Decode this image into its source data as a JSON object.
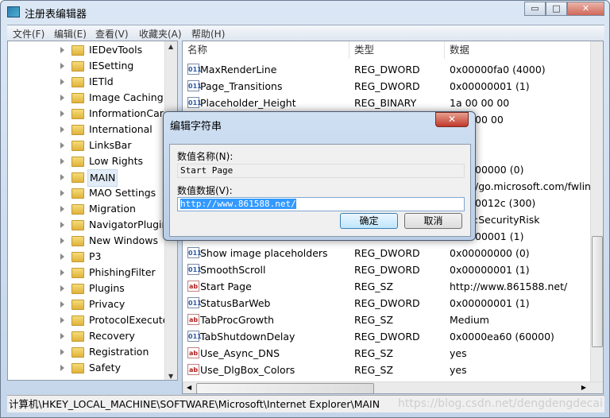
{
  "window": {
    "title": "注册表编辑器",
    "minimize": "▭",
    "maximize": "□",
    "close": "✕"
  },
  "menu": [
    "文件(F)",
    "编辑(E)",
    "查看(V)",
    "收藏夹(A)",
    "帮助(H)"
  ],
  "tree": {
    "items": [
      {
        "label": "IEDevTools"
      },
      {
        "label": "IESetting"
      },
      {
        "label": "IETld"
      },
      {
        "label": "Image Caching"
      },
      {
        "label": "InformationCard"
      },
      {
        "label": "International"
      },
      {
        "label": "LinksBar"
      },
      {
        "label": "Low Rights"
      },
      {
        "label": "MAIN",
        "selected": true
      },
      {
        "label": "MAO Settings"
      },
      {
        "label": "Migration"
      },
      {
        "label": "NavigatorPluginsL"
      },
      {
        "label": "New Windows"
      },
      {
        "label": "P3"
      },
      {
        "label": "PhishingFilter"
      },
      {
        "label": "Plugins"
      },
      {
        "label": "Privacy"
      },
      {
        "label": "ProtocolExecute"
      },
      {
        "label": "Recovery"
      },
      {
        "label": "Registration"
      },
      {
        "label": "Safety"
      }
    ]
  },
  "list": {
    "headers": {
      "name": "名称",
      "type": "类型",
      "data": "数据"
    },
    "rows": [
      {
        "icon": "dword-icon",
        "name": "MaxRenderLine",
        "type": "REG_DWORD",
        "data": "0x00000fa0 (4000)"
      },
      {
        "icon": "dword-icon",
        "name": "Page_Transitions",
        "type": "REG_DWORD",
        "data": "0x00000001 (1)"
      },
      {
        "icon": "dword-icon",
        "name": "Placeholder_Height",
        "type": "REG_BINARY",
        "data": "1a 00 00 00"
      },
      {
        "icon": "",
        "name": "",
        "type": "",
        "data": "00 00"
      },
      {
        "icon": "",
        "name": "",
        "type": "",
        "data": ""
      },
      {
        "icon": "",
        "name": "",
        "type": "",
        "data": ""
      },
      {
        "icon": "",
        "name": "",
        "type": "",
        "data": "00000 (0)"
      },
      {
        "icon": "",
        "name": "",
        "type": "",
        "data": "/go.microsoft.com/fwlink"
      },
      {
        "icon": "",
        "name": "",
        "type": "",
        "data": "0012c (300)"
      },
      {
        "icon": "",
        "name": "",
        "type": "",
        "data": ":SecurityRisk"
      },
      {
        "icon": "",
        "name": "",
        "type": "",
        "data": "00001 (1)"
      },
      {
        "icon": "dword-icon",
        "name": "Show image placeholders",
        "type": "REG_DWORD",
        "data": "0x00000000 (0)"
      },
      {
        "icon": "dword-icon",
        "name": "SmoothScroll",
        "type": "REG_DWORD",
        "data": "0x00000001 (1)"
      },
      {
        "icon": "string-icon",
        "name": "Start Page",
        "type": "REG_SZ",
        "data": "http://www.861588.net/"
      },
      {
        "icon": "dword-icon",
        "name": "StatusBarWeb",
        "type": "REG_DWORD",
        "data": "0x00000001 (1)"
      },
      {
        "icon": "string-icon",
        "name": "TabProcGrowth",
        "type": "REG_SZ",
        "data": "Medium"
      },
      {
        "icon": "dword-icon",
        "name": "TabShutdownDelay",
        "type": "REG_DWORD",
        "data": "0x0000ea60 (60000)"
      },
      {
        "icon": "string-icon",
        "name": "Use_Async_DNS",
        "type": "REG_SZ",
        "data": "yes"
      },
      {
        "icon": "string-icon",
        "name": "Use_DlgBox_Colors",
        "type": "REG_SZ",
        "data": "yes"
      }
    ]
  },
  "status": "计算机\\HKEY_LOCAL_MACHINE\\SOFTWARE\\Microsoft\\Internet Explorer\\MAIN",
  "watermark": "https://blog.csdn.net/dengdengdecai",
  "dialog": {
    "title": "编辑字符串",
    "name_label": "数值名称(N):",
    "name_value": "Start Page",
    "data_label": "数值数据(V):",
    "data_value": "http://www.861588.net/",
    "ok": "确定",
    "cancel": "取消"
  }
}
